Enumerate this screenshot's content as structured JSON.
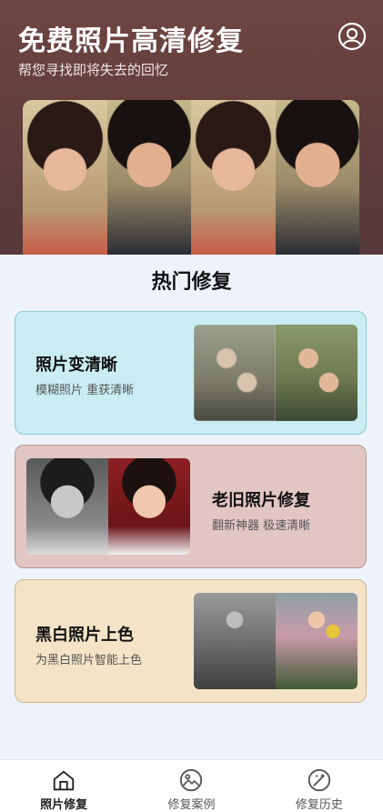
{
  "header": {
    "title": "免费照片高清修复",
    "subtitle": "帮您寻找即将失去的回忆",
    "user_icon": "user-circle-icon"
  },
  "section_title": "热门修复",
  "cards": [
    {
      "title": "照片变清晰",
      "subtitle": "模糊照片 重获清晰"
    },
    {
      "title": "老旧照片修复",
      "subtitle": "翻新神器 极速清晰"
    },
    {
      "title": "黑白照片上色",
      "subtitle": "为黑白照片智能上色"
    }
  ],
  "tabs": [
    {
      "label": "照片修复",
      "icon": "home-icon",
      "active": true
    },
    {
      "label": "修复案例",
      "icon": "image-icon",
      "active": false
    },
    {
      "label": "修复历史",
      "icon": "magic-icon",
      "active": false
    }
  ],
  "colors": {
    "header_bg": "#6f4543",
    "card1_bg": "#c9edf3",
    "card2_bg": "#e2c6c4",
    "card3_bg": "#f4e3c7"
  }
}
